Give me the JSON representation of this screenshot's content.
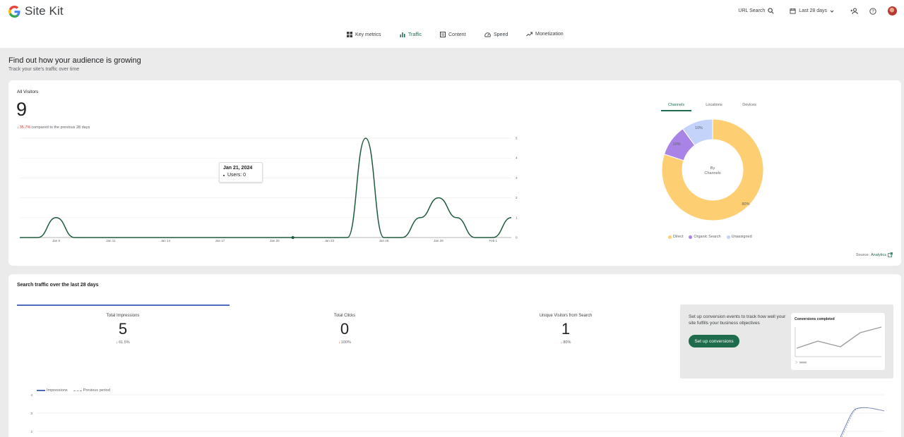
{
  "app": {
    "name": "Site Kit"
  },
  "header": {
    "url_search_label": "URL Search",
    "date_range_label": "Last 28 days"
  },
  "nav": {
    "items": [
      {
        "label": "Key metrics",
        "icon": "grid-icon"
      },
      {
        "label": "Traffic",
        "icon": "bar-chart-icon",
        "active": true
      },
      {
        "label": "Content",
        "icon": "document-icon"
      },
      {
        "label": "Speed",
        "icon": "speedometer-icon"
      },
      {
        "label": "Monetization",
        "icon": "trending-up-icon"
      }
    ]
  },
  "page": {
    "title": "Find out how your audience is growing",
    "subtitle": "Track your site's traffic over time"
  },
  "all_visitors": {
    "label": "All Visitors",
    "value": "9",
    "delta": "35.7%",
    "delta_suffix": "compared to the previous 28 days",
    "tooltip": {
      "date": "Jan 21, 2024",
      "line": "Users: 0"
    },
    "tabs": [
      "Channels",
      "Locations",
      "Devices"
    ],
    "donut_center": [
      "By",
      "Channels"
    ],
    "source_label": "Source:",
    "source_link": "Analytics"
  },
  "chart_data": [
    {
      "type": "line",
      "title": "",
      "x_ticks": [
        "Jan 8",
        "Jan 11",
        "Jan 14",
        "Jan 17",
        "Jan 20",
        "Jan 23",
        "Jan 26",
        "Jan 29",
        "Feb 1"
      ],
      "x": [
        "Jan 6",
        "Jan 7",
        "Jan 8",
        "Jan 9",
        "Jan 10",
        "Jan 11",
        "Jan 12",
        "Jan 13",
        "Jan 14",
        "Jan 15",
        "Jan 16",
        "Jan 17",
        "Jan 18",
        "Jan 19",
        "Jan 20",
        "Jan 21",
        "Jan 22",
        "Jan 23",
        "Jan 24",
        "Jan 25",
        "Jan 26",
        "Jan 27",
        "Jan 28",
        "Jan 29",
        "Jan 30",
        "Jan 31",
        "Feb 1",
        "Feb 2"
      ],
      "series": [
        {
          "values": [
            0,
            0,
            1,
            0,
            0,
            0,
            0,
            0,
            0,
            0,
            0,
            0,
            0,
            0,
            0,
            0,
            0,
            0,
            0,
            5,
            0,
            0,
            1,
            2,
            1,
            0,
            0,
            1
          ],
          "color": "#1e5a3c"
        }
      ],
      "ylim": [
        0,
        5
      ],
      "y_ticks": [
        0,
        1,
        2,
        3,
        4,
        5
      ]
    },
    {
      "type": "pie",
      "categories": [
        "Direct",
        "Organic Search",
        "Unassigned"
      ],
      "values": [
        80,
        10,
        10
      ],
      "labels": [
        "80%",
        "10%",
        "10%"
      ],
      "colors": [
        "#fece72",
        "#a983e6",
        "#c4d3f9"
      ],
      "legend": "bottom"
    }
  ],
  "search_traffic": {
    "title": "Search traffic over the last 28 days",
    "metrics": [
      {
        "label": "Total Impressions",
        "value": "5",
        "delta": "61.5%",
        "selected": true
      },
      {
        "label": "Total Clicks",
        "value": "0",
        "delta": "100%"
      },
      {
        "label": "Unique Visitors from Search",
        "value": "1",
        "delta": "80%"
      }
    ],
    "legend": [
      "Impressions",
      "Previous period"
    ],
    "y_ticks": [
      "4",
      "3",
      "2"
    ],
    "promo": {
      "text": "Set up conversion events to track how well your site fulfills your business objectives",
      "button": "Set up conversions",
      "mini_chart_title": "Conversions completed"
    }
  }
}
